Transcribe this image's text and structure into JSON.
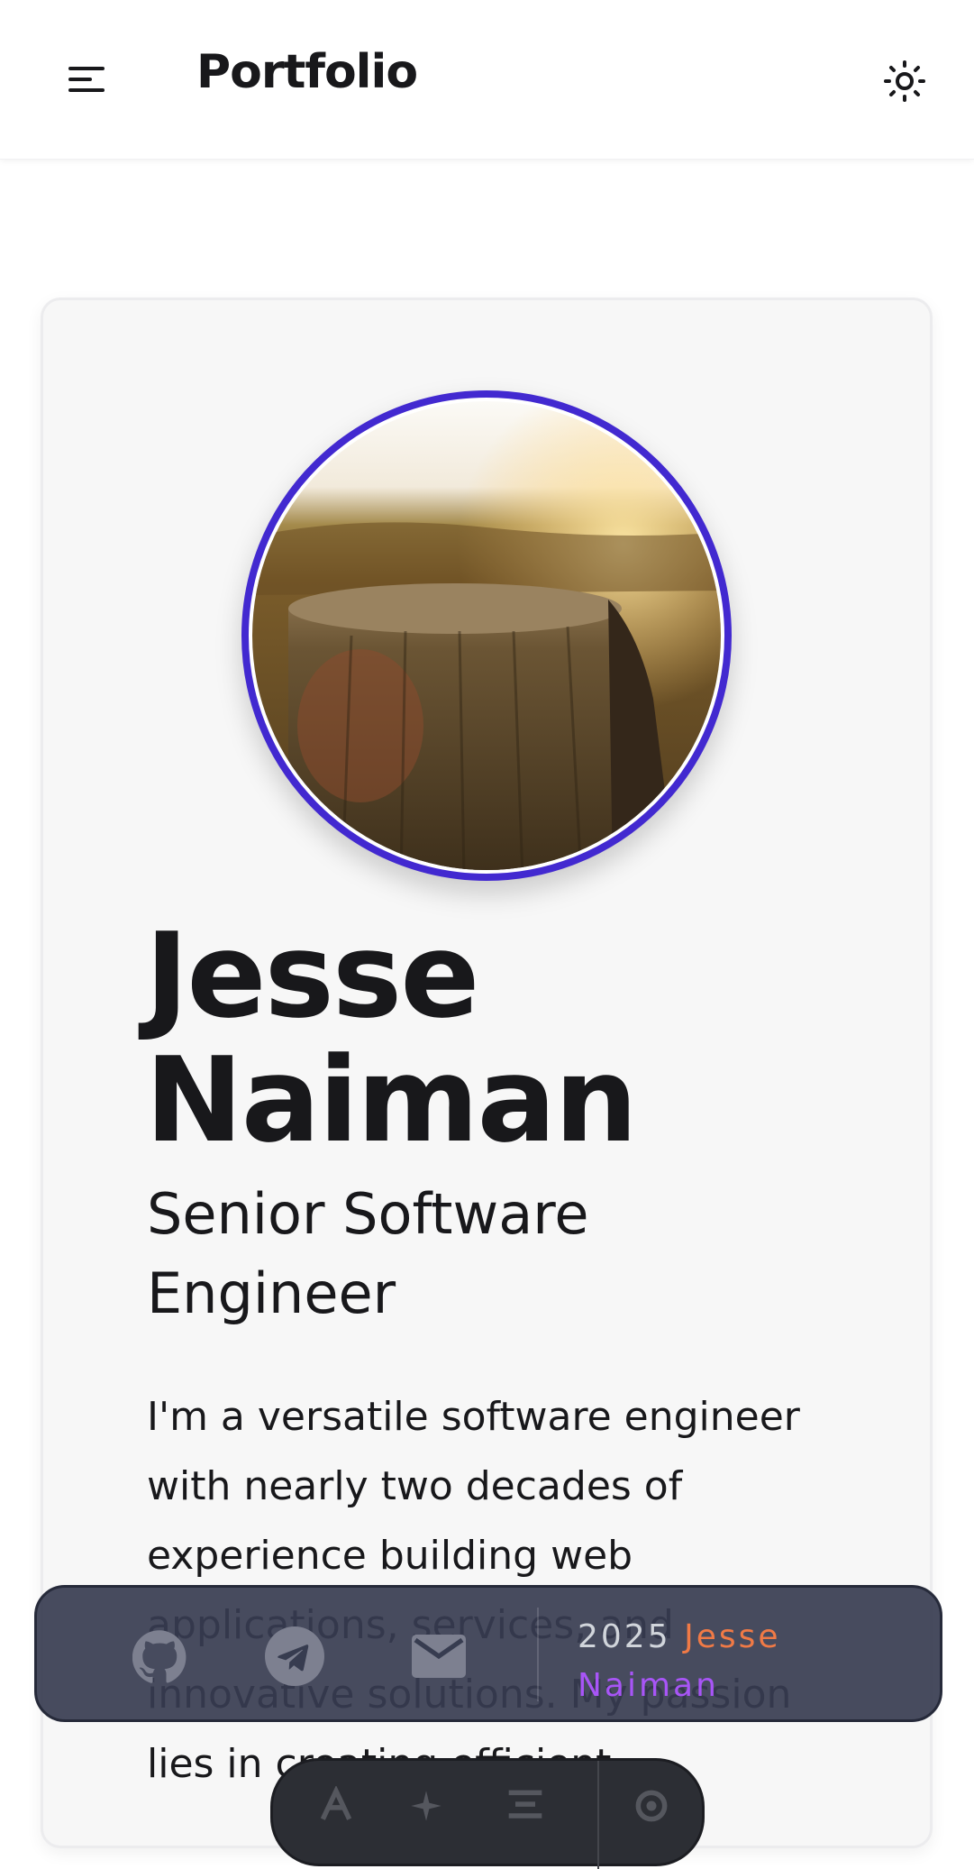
{
  "header": {
    "brand": "Portfolio",
    "menu_icon": "menu-icon",
    "theme_icon": "sun-icon"
  },
  "profile": {
    "photo": "tree-stump-photo",
    "name": "Jesse Naiman",
    "role": "Senior Software Engineer",
    "bio": "I'm a versatile software engineer with nearly two decades of experience building web applications, services, and innovative solutions. My passion lies in creating efficient"
  },
  "footer": {
    "links": [
      {
        "icon": "github-icon"
      },
      {
        "icon": "telegram-icon"
      },
      {
        "icon": "mail-icon"
      }
    ],
    "year": "2025",
    "first_name": "Jesse",
    "last_name": "Naiman"
  },
  "dock": {
    "items": [
      {
        "icon": "text-icon"
      },
      {
        "icon": "sparkle-icon"
      },
      {
        "icon": "align-icon"
      },
      {
        "icon": "settings-icon"
      }
    ]
  },
  "colors": {
    "accent": "#4229d0",
    "footer_bg": "#373c50",
    "name_first": "#f07a46",
    "name_last": "#a855f7"
  }
}
